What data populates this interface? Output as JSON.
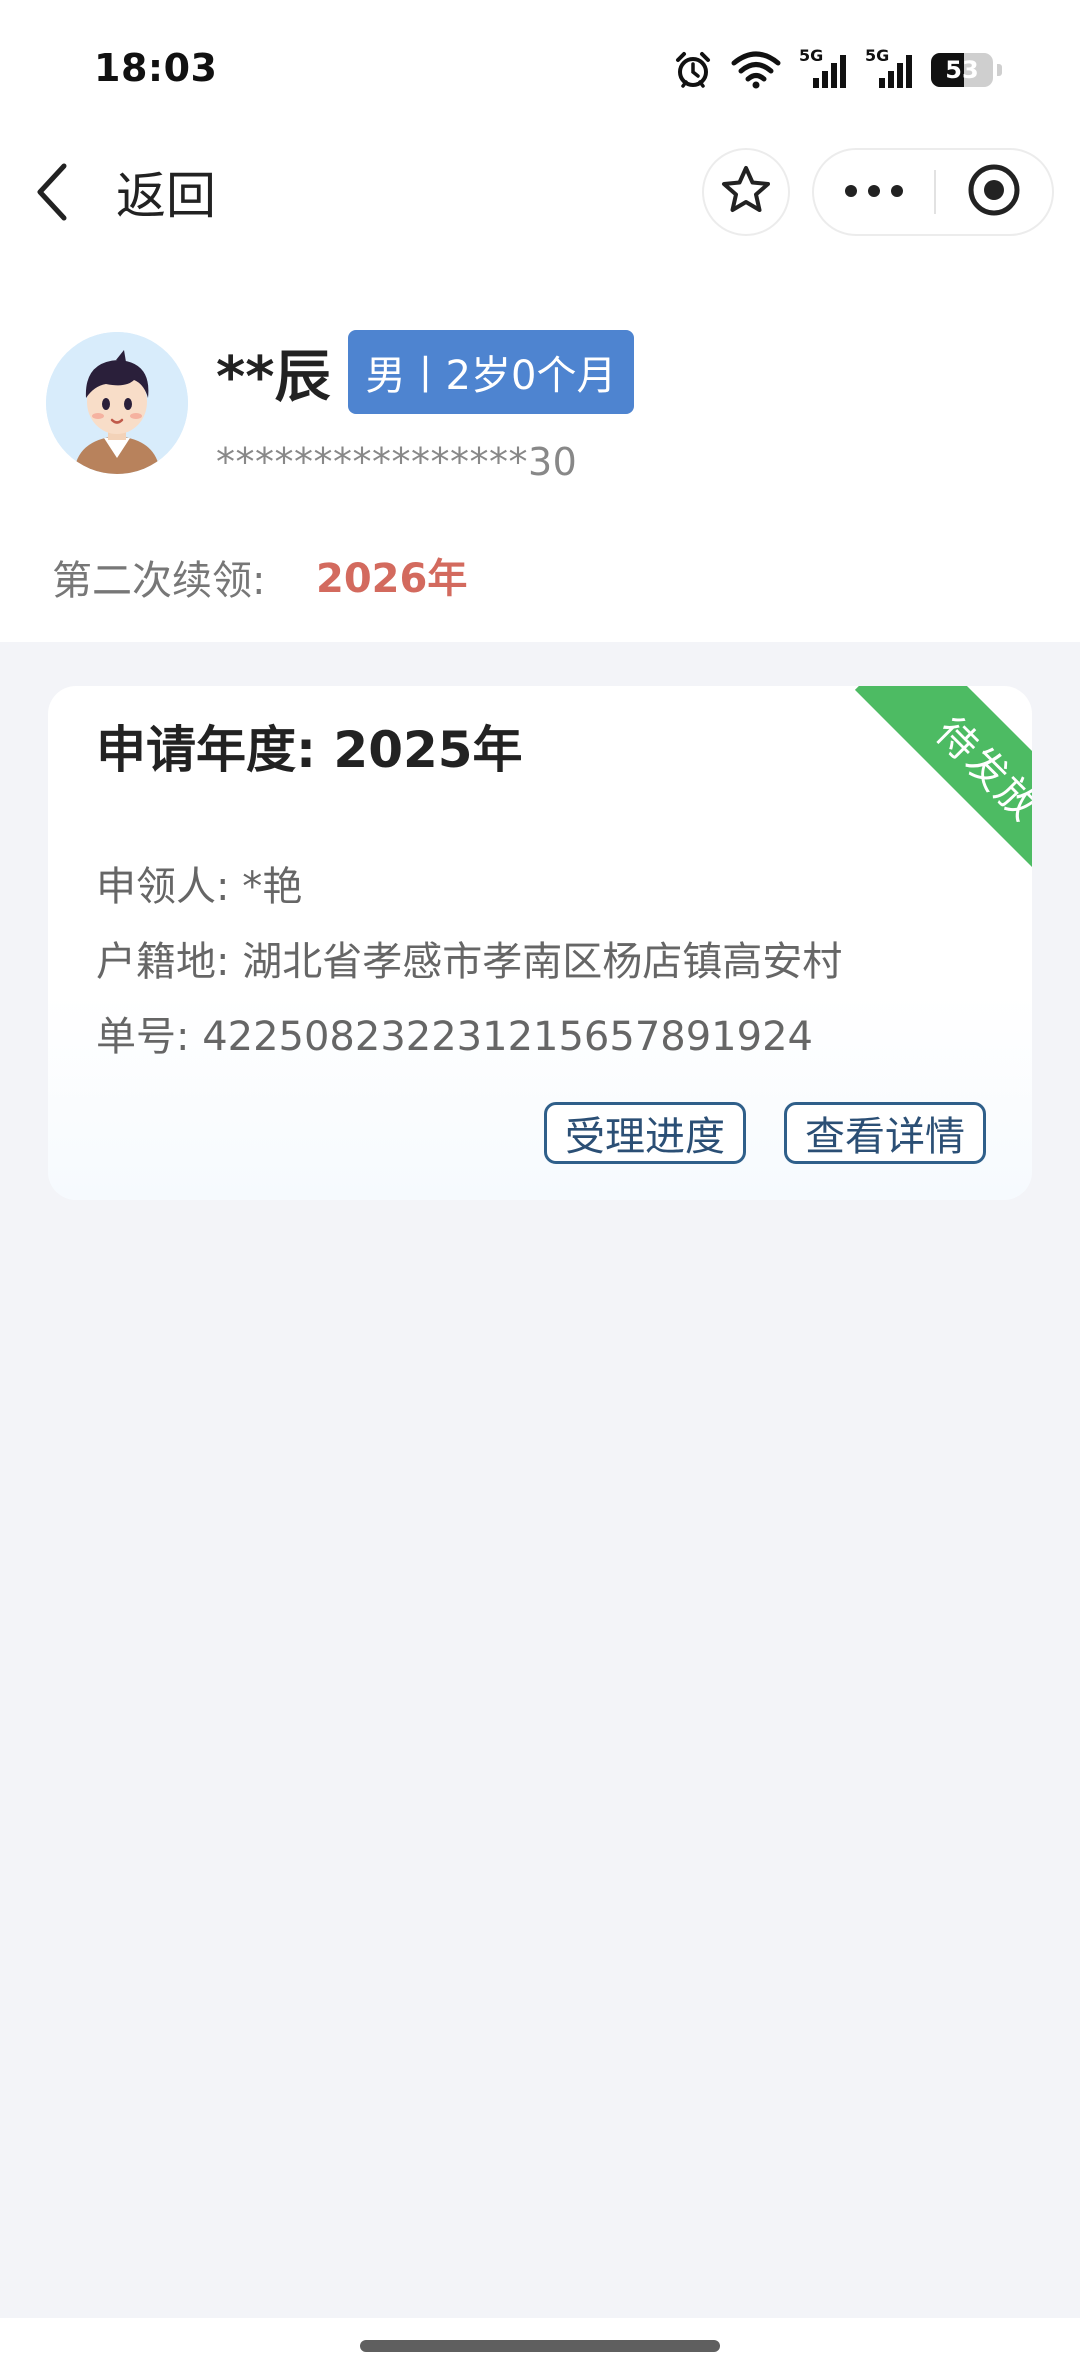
{
  "status_bar": {
    "time": "18:03",
    "battery": "53",
    "network_label_1": "5G",
    "network_label_2": "5G",
    "icons": [
      "alarm-icon",
      "wifi-icon",
      "signal-5g-icon",
      "signal-5g-icon",
      "battery-icon"
    ]
  },
  "nav": {
    "back_label": "返回",
    "icons": [
      "chevron-left-icon",
      "star-icon",
      "more-icon",
      "target-icon"
    ]
  },
  "profile": {
    "name": "**辰",
    "gender_age": "男丨2岁0个月",
    "id_number": "****************30",
    "renew_label": "第二次续领:",
    "renew_year": "2026年"
  },
  "card": {
    "title": "申请年度: 2025年",
    "status": "待发放",
    "applicant": "申领人: *艳",
    "residence": "户籍地: 湖北省孝感市孝南区杨店镇高安村",
    "order_no": "单号: 422508232231215657891924",
    "progress_button": "受理进度",
    "detail_button": "查看详情"
  },
  "colors": {
    "badge_blue": "#4e84d0",
    "renew_red": "#d36a5e",
    "status_green": "#4dbb63",
    "button_border": "#2f5f8a"
  }
}
